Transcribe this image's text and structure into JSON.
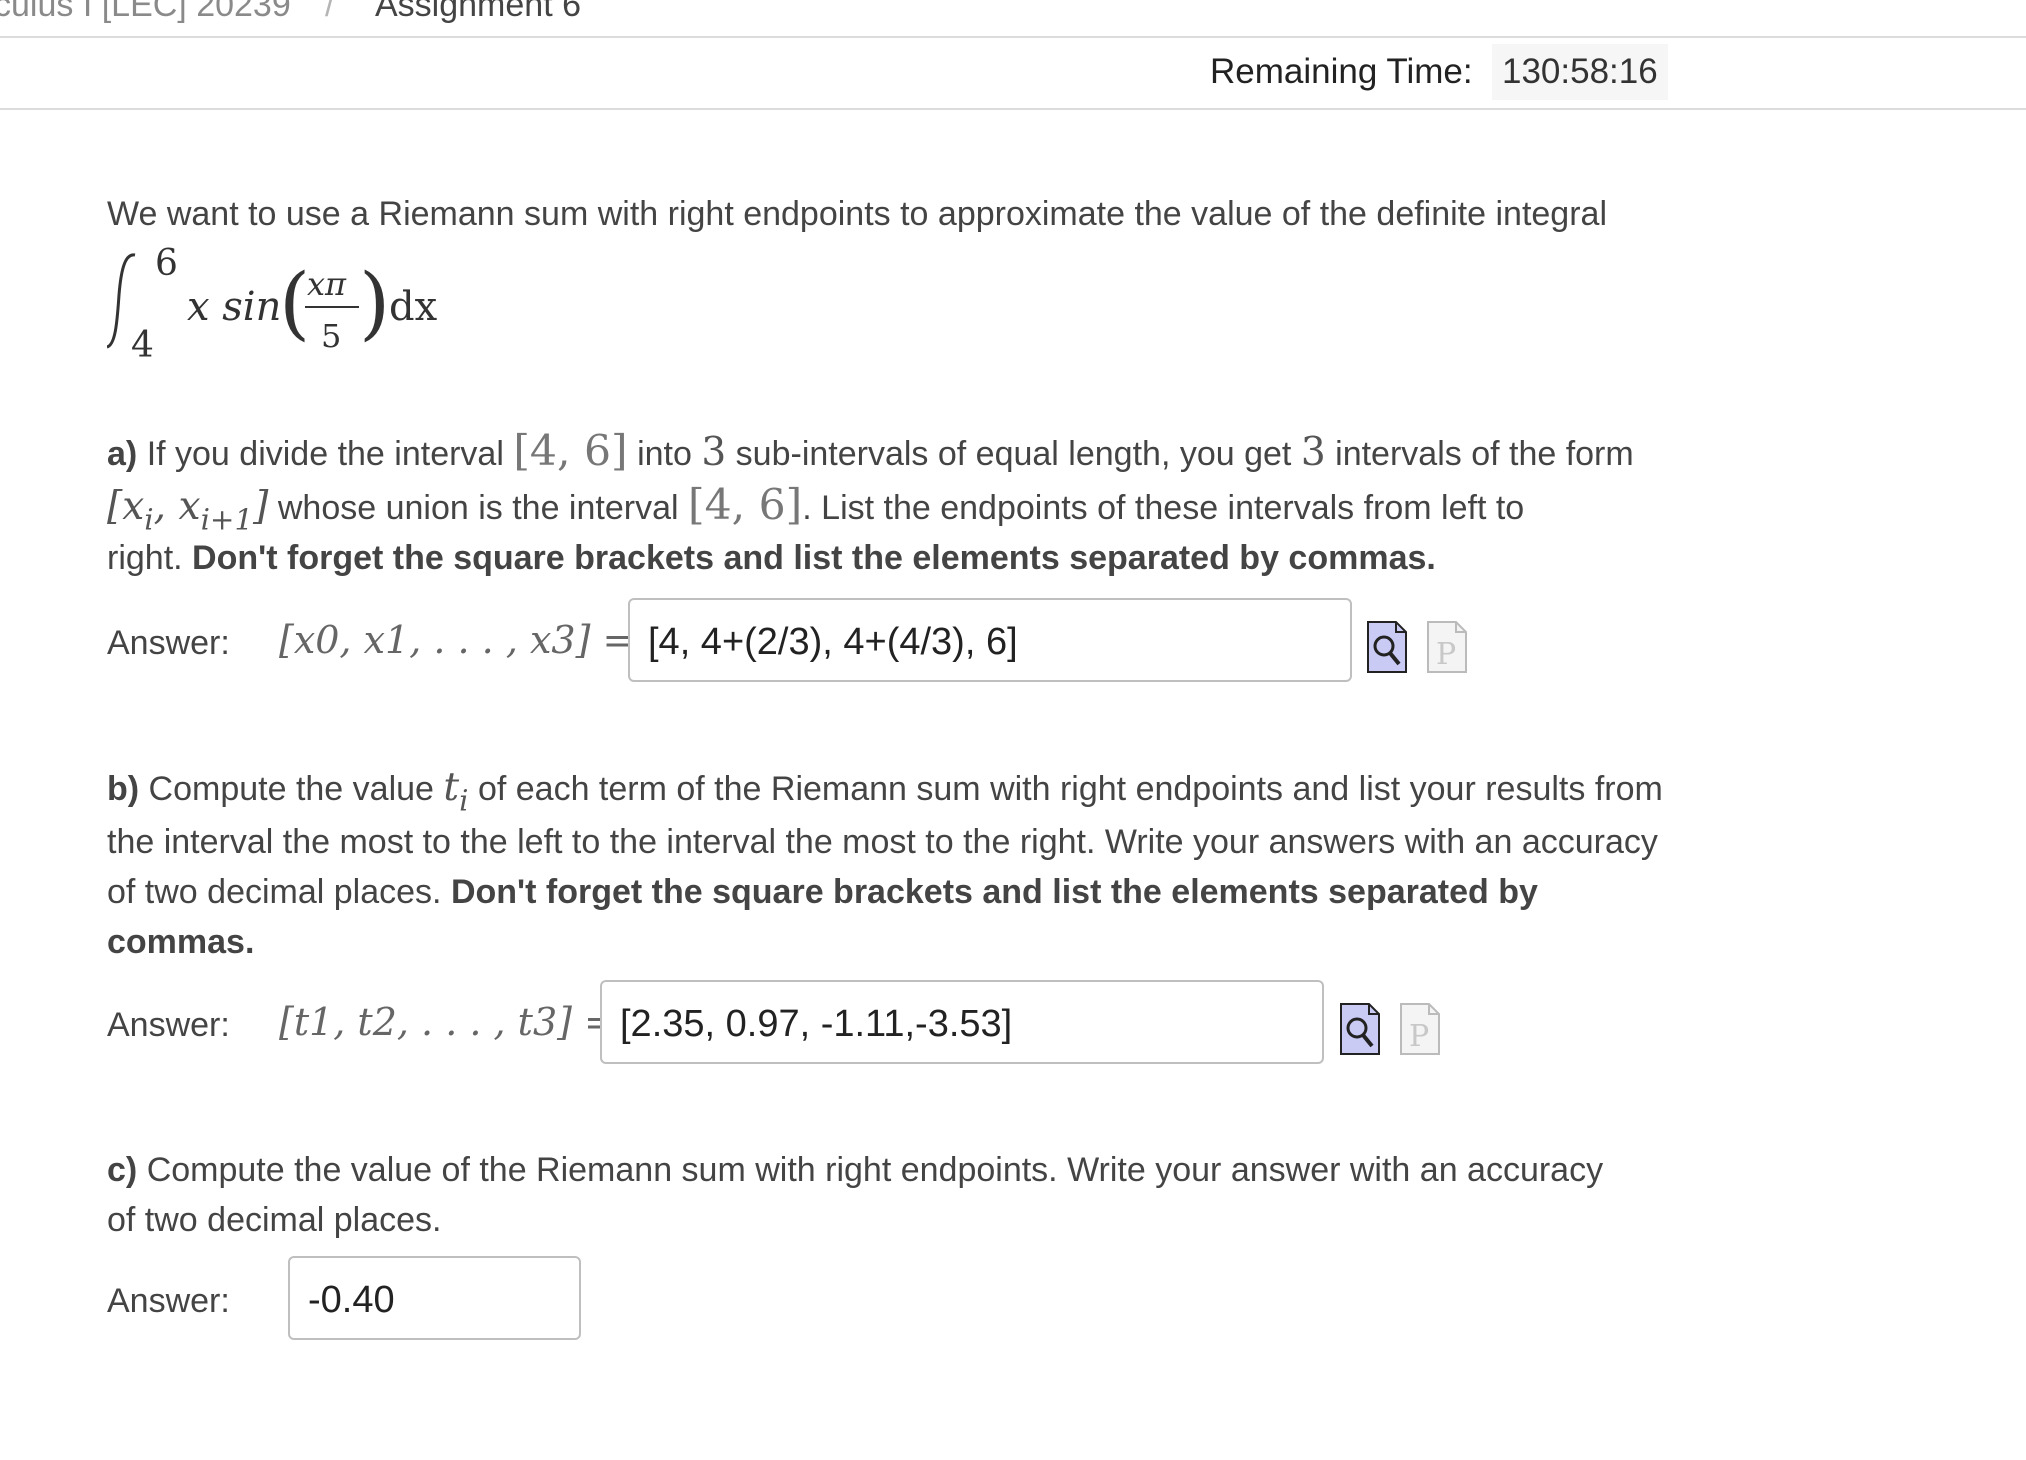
{
  "breadcrumb": {
    "course": "culus I [LEC] 20239",
    "separator": "/",
    "assignment": "Assignment 6"
  },
  "timer": {
    "label": "Remaining Time:",
    "value": "130:58:16"
  },
  "intro": {
    "text": "We want to use a Riemann sum with right endpoints to approximate the value of the definite integral",
    "integral": {
      "lower": "4",
      "upper": "6",
      "integrand_pre": "x sin",
      "numerator": "xπ",
      "denominator": "5",
      "differential": "dx"
    }
  },
  "part_a": {
    "marker": "a)",
    "line1_pre": "If you divide the interval",
    "interval": "[4, 6]",
    "line1_mid": "into",
    "count": "3",
    "line1_mid2": "sub-intervals of equal length, you get",
    "line1_post": "intervals of the form",
    "form": "[x",
    "form_sub_i": "i",
    "form_mid": ", x",
    "form_sub_i1": "i+1",
    "form_end": "]",
    "line2_mid": "whose union is the interval",
    "line2_post": ". List the endpoints of these intervals from left to",
    "line3_pre": "right.",
    "line3_bold": "Don't forget the square brackets and list the elements separated by commas.",
    "answer_label": "Answer:",
    "answer_math_lhs": "[x0, x1, . . . , x3] =",
    "answer_value": "[4, 4+(2/3), 4+(4/3), 6]"
  },
  "part_b": {
    "marker": "b)",
    "line1_pre": "Compute the value",
    "ti": "t",
    "ti_sub": "i",
    "line1_post": "of each term of the Riemann sum with right endpoints and list your results from",
    "line2": "the interval the most to the left to the interval the most to the right. Write your answers with an accuracy",
    "line3_pre": "of two decimal places.",
    "line3_bold": "Don't forget the square brackets and list the elements separated by",
    "line4_bold": "commas.",
    "answer_label": "Answer:",
    "answer_math_lhs": "[t1, t2, . . . , t3] =",
    "answer_value": "[2.35, 0.97, -1.11,-3.53]"
  },
  "part_c": {
    "marker": "c)",
    "line1": "Compute the value of the Riemann sum with right endpoints. Write your answer with an accuracy",
    "line2": "of two decimal places.",
    "answer_label": "Answer:",
    "answer_value": "-0.40"
  },
  "icons": {
    "preview": "preview-magnifier-icon",
    "formula_help": "formula-editor-icon"
  }
}
